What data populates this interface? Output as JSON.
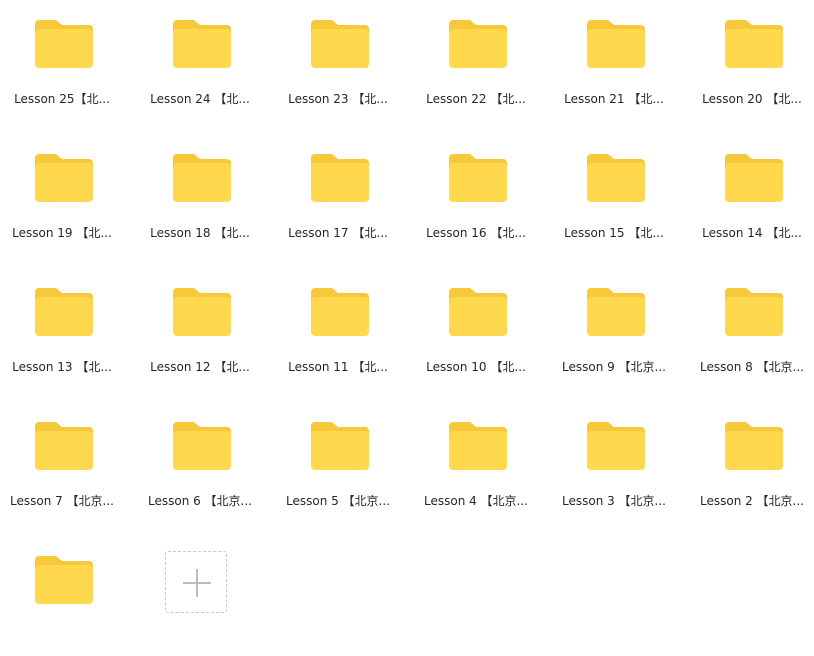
{
  "folders": [
    {
      "label": "Lesson 25【北..."
    },
    {
      "label": "Lesson 24 【北..."
    },
    {
      "label": "Lesson 23 【北..."
    },
    {
      "label": "Lesson 22 【北..."
    },
    {
      "label": "Lesson 21 【北..."
    },
    {
      "label": "Lesson 20 【北..."
    },
    {
      "label": "Lesson 19 【北..."
    },
    {
      "label": "Lesson 18 【北..."
    },
    {
      "label": "Lesson 17 【北..."
    },
    {
      "label": "Lesson 16 【北..."
    },
    {
      "label": "Lesson 15 【北..."
    },
    {
      "label": "Lesson 14 【北..."
    },
    {
      "label": "Lesson 13 【北..."
    },
    {
      "label": "Lesson 12 【北..."
    },
    {
      "label": "Lesson 11 【北..."
    },
    {
      "label": "Lesson 10 【北..."
    },
    {
      "label": "Lesson 9 【北京..."
    },
    {
      "label": "Lesson 8 【北京..."
    },
    {
      "label": "Lesson 7 【北京..."
    },
    {
      "label": "Lesson 6 【北京..."
    },
    {
      "label": "Lesson 5 【北京..."
    },
    {
      "label": "Lesson 4 【北京..."
    },
    {
      "label": "Lesson 3 【北京..."
    },
    {
      "label": "Lesson 2 【北京..."
    },
    {
      "label": ""
    }
  ],
  "icons": {
    "folder": "folder-icon",
    "add": "plus-icon"
  },
  "colors": {
    "folder_body": "#FFD84D",
    "folder_tab": "#F6C83A",
    "text": "#262626",
    "dashed_border": "#C8C8C8",
    "plus": "#BDBDBD"
  }
}
